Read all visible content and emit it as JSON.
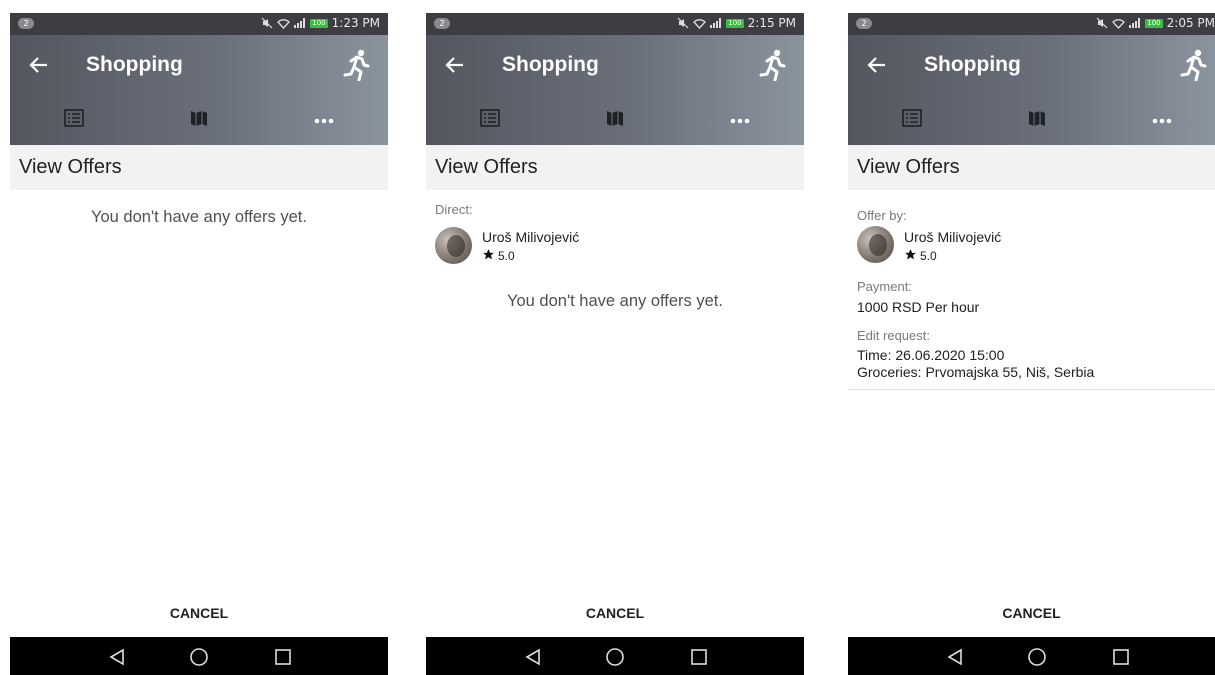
{
  "screens": [
    {
      "status": {
        "notifications": "2",
        "battery": "100",
        "time": "1:23 PM"
      },
      "title": "Shopping",
      "section": "View Offers",
      "empty_message": "You don't have any offers yet.",
      "cancel": "CANCEL"
    },
    {
      "status": {
        "notifications": "2",
        "battery": "100",
        "time": "2:15 PM"
      },
      "title": "Shopping",
      "section": "View Offers",
      "direct_label": "Direct:",
      "user": {
        "name": "Uroš Milivojević",
        "rating": "5.0"
      },
      "empty_message": "You don't have any offers yet.",
      "cancel": "CANCEL"
    },
    {
      "status": {
        "notifications": "2",
        "battery": "100",
        "time": "2:05 PM"
      },
      "title": "Shopping",
      "section": "View Offers",
      "offer": {
        "offer_by_label": "Offer by:",
        "user": {
          "name": "Uroš Milivojević",
          "rating": "5.0"
        },
        "payment_label": "Payment:",
        "payment_value": "1000 RSD Per hour",
        "edit_label": "Edit request:",
        "time_line": "Time: 26.06.2020 15:00",
        "location_line": "Groceries: Prvomajska 55, Niš, Serbia"
      },
      "cancel": "CANCEL"
    }
  ],
  "icons": {
    "back": "arrow-left-icon",
    "run": "running-person-icon",
    "tab1": "list-icon",
    "tab2": "map-icon",
    "tab3": "more-horizontal-icon",
    "star": "star-icon",
    "nav_back": "nav-back-triangle-icon",
    "nav_home": "nav-home-circle-icon",
    "nav_recents": "nav-recents-square-icon"
  },
  "colors": {
    "appbar_start": "#54565f",
    "appbar_end": "#8a949f",
    "battery": "#35c23a",
    "section_bg": "#f2f2f4"
  }
}
